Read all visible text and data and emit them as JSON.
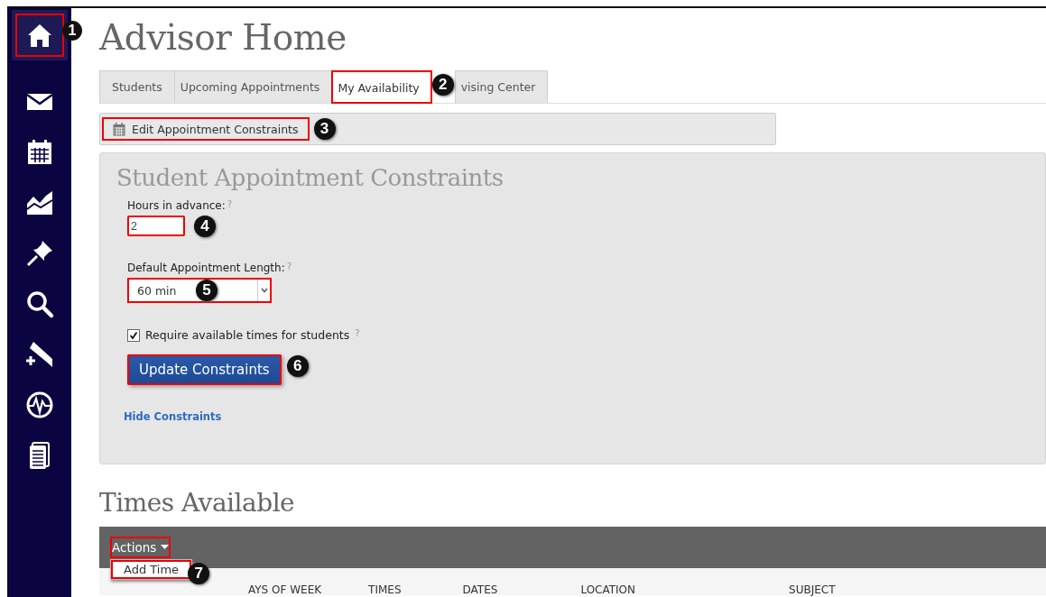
{
  "sidebar": {
    "items": [
      {
        "selected": true,
        "callout": "1"
      },
      {
        "selected": false
      },
      {
        "selected": false
      },
      {
        "selected": false
      },
      {
        "selected": false
      },
      {
        "selected": false
      },
      {
        "selected": false
      },
      {
        "selected": false
      },
      {
        "selected": false
      }
    ]
  },
  "page_title": "Advisor Home",
  "tabs": [
    {
      "label": "Students",
      "selected": false
    },
    {
      "label": "Upcoming Appointments",
      "selected": false
    },
    {
      "label": "My Availability",
      "selected": true,
      "callout": "2"
    },
    {
      "label": "vising Center",
      "selected": false
    }
  ],
  "toolbar": {
    "button": "Edit Appointment Constraints",
    "callout": "3"
  },
  "constraints": {
    "title": "Student Appointment Constraints",
    "hours": {
      "label": "Hours in advance:",
      "help": "?",
      "value": "2",
      "callout": "4"
    },
    "length": {
      "label": "Default Appointment Length:",
      "help": "?",
      "value": "60 min",
      "callout": "5"
    },
    "require": {
      "label": "Require available times for students",
      "help": "?",
      "checked": true
    },
    "update_button": {
      "label": "Update Constraints",
      "callout": "6"
    },
    "hide_link": "Hide Constraints"
  },
  "times": {
    "title": "Times Available",
    "actions": "Actions",
    "menu": [
      {
        "label": "Add Time",
        "callout": "7"
      }
    ],
    "columns": [
      "AYS OF WEEK",
      "TIMES",
      "DATES",
      "LOCATION",
      "SUBJECT"
    ]
  }
}
